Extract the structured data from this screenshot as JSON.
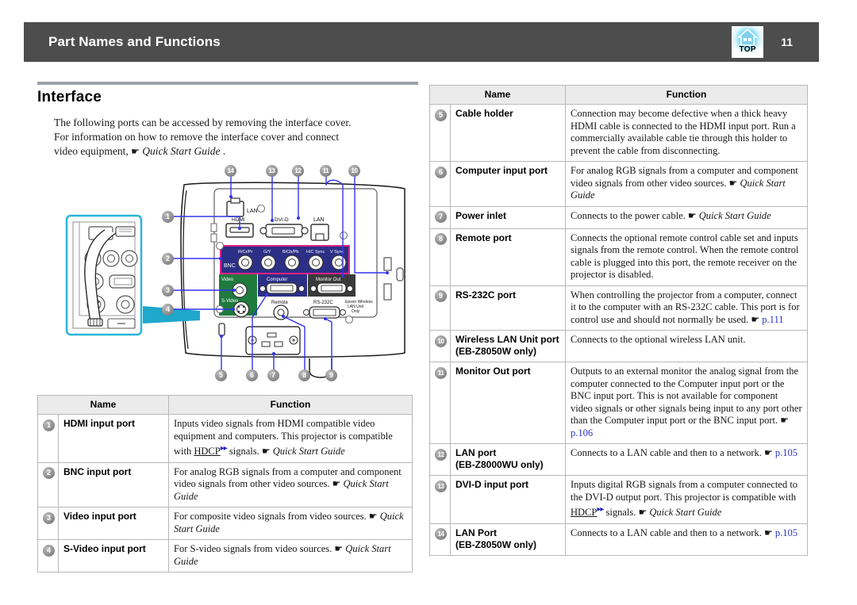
{
  "header": {
    "title": "Part Names and Functions",
    "top_icon_label": "TOP",
    "page_number": "11"
  },
  "section": {
    "title": "Interface",
    "intro_line1": "The  following  ports  can  be  accessed  by  removing  the  interface  cover.",
    "intro_line2": "For  information  on  how  to  remove  the  interface  cover  and  connect",
    "intro_line3_pre": "video  equipment, ",
    "intro_line3_hand": "☛",
    "intro_line3_ref": "Quick Start Guide",
    "intro_line3_post": " ."
  },
  "diagram": {
    "callouts_top": [
      "14",
      "13",
      "12",
      "11",
      "10"
    ],
    "callouts_left": [
      "1",
      "2",
      "3",
      "4"
    ],
    "callouts_bottom": [
      "5",
      "6",
      "7",
      "8",
      "9"
    ],
    "port_labels": {
      "lan_top": "LAN",
      "hdmi": "HDMI",
      "dvid": "DVI-D",
      "lan_right": "LAN",
      "bnc": "BNC",
      "bnc_pins": [
        "R/Cr/Pr",
        "G/Y",
        "B/Cb/Pb",
        "H/C Sync",
        "V Sync"
      ],
      "video": "Video",
      "svideo": "S-Video",
      "computer": "Computer",
      "monitor_out": "Monitor Out",
      "remote": "Remote",
      "rs232c": "RS-232C",
      "wireless": "Epson Wireless LAN Unit Only"
    },
    "colors": {
      "bnc_panel": "#2c2f86",
      "bnc_border": "#e0218a",
      "video_panel": "#1f7a3d",
      "computer_panel": "#2c2f86",
      "monitor_panel": "#3a3a3a",
      "callout_line": "#3333ee",
      "inset_border": "#29b6d8"
    }
  },
  "tables": {
    "headers": {
      "name": "Name",
      "function": "Function"
    },
    "left_rows": [
      {
        "num": "1",
        "name": "HDMI input port",
        "function_html": "Inputs video signals from HDMI compatible video equipment and computers. This projector is compatible with <u>HDCP</u><sup>▸▸</sup> signals. ☛ <i>Quick Start Guide</i>",
        "function_text": "Inputs video signals from HDMI compatible video equipment and computers. This projector is compatible with HDCP signals. Quick Start Guide"
      },
      {
        "num": "2",
        "name": "BNC input port",
        "function_text": "For analog RGB signals from a computer and component video signals from other video sources. Quick Start Guide"
      },
      {
        "num": "3",
        "name": "Video input port",
        "function_text": "For composite video signals from video sources. Quick Start Guide"
      },
      {
        "num": "4",
        "name": "S-Video input port",
        "function_text": "For S-video signals from video sources. Quick Start Guide"
      }
    ],
    "right_rows": [
      {
        "num": "5",
        "name": "Cable holder",
        "function_text": "Connection may become defective when a thick heavy HDMI cable is connected to the HDMI input port. Run a commercially available cable tie through this holder to prevent the cable from disconnecting."
      },
      {
        "num": "6",
        "name": "Computer input port",
        "function_text": "For analog RGB signals from a computer and component video signals from other video sources. Quick Start Guide"
      },
      {
        "num": "7",
        "name": "Power inlet",
        "function_text": "Connects to the power cable. Quick Start Guide"
      },
      {
        "num": "8",
        "name": "Remote port",
        "function_text": "Connects the optional remote control cable set and inputs signals from the remote control. When the remote control cable is plugged into this port, the remote receiver on the projector is disabled."
      },
      {
        "num": "9",
        "name": "RS-232C port",
        "function_text": "When controlling the projector from a computer, connect it to the computer with an RS-232C cable. This port is for control use and should not normally be used. p.111",
        "link": "p.111"
      },
      {
        "num": "10",
        "name": "Wireless LAN Unit port (EB-Z8050W only)",
        "function_text": "Connects to the optional wireless LAN unit."
      },
      {
        "num": "11",
        "name": "Monitor Out port",
        "function_text": "Outputs to an external monitor the analog signal from the computer connected to the Computer input port or the BNC input port. This is not available for component video signals or other signals being input to any port other than the Computer input port or the BNC input port. p.106",
        "link": "p.106"
      },
      {
        "num": "12",
        "name": "LAN port (EB-Z8000WU only)",
        "function_text": "Connects to a LAN cable and then to a network. p.105",
        "link": "p.105"
      },
      {
        "num": "13",
        "name": "DVI-D input port",
        "function_text": "Inputs digital RGB signals from a computer connected to the DVI-D output port. This projector is compatible with HDCP signals. Quick Start Guide"
      },
      {
        "num": "14",
        "name": "LAN Port (EB-Z8050W only)",
        "function_text": "Connects to a LAN cable and then to a network. p.105",
        "link": "p.105"
      }
    ]
  },
  "colors": {
    "header_bar": "#4d4d4d",
    "rule": "#9aa2a6",
    "table_header_bg": "#ebebeb",
    "link": "#2b33c8"
  }
}
